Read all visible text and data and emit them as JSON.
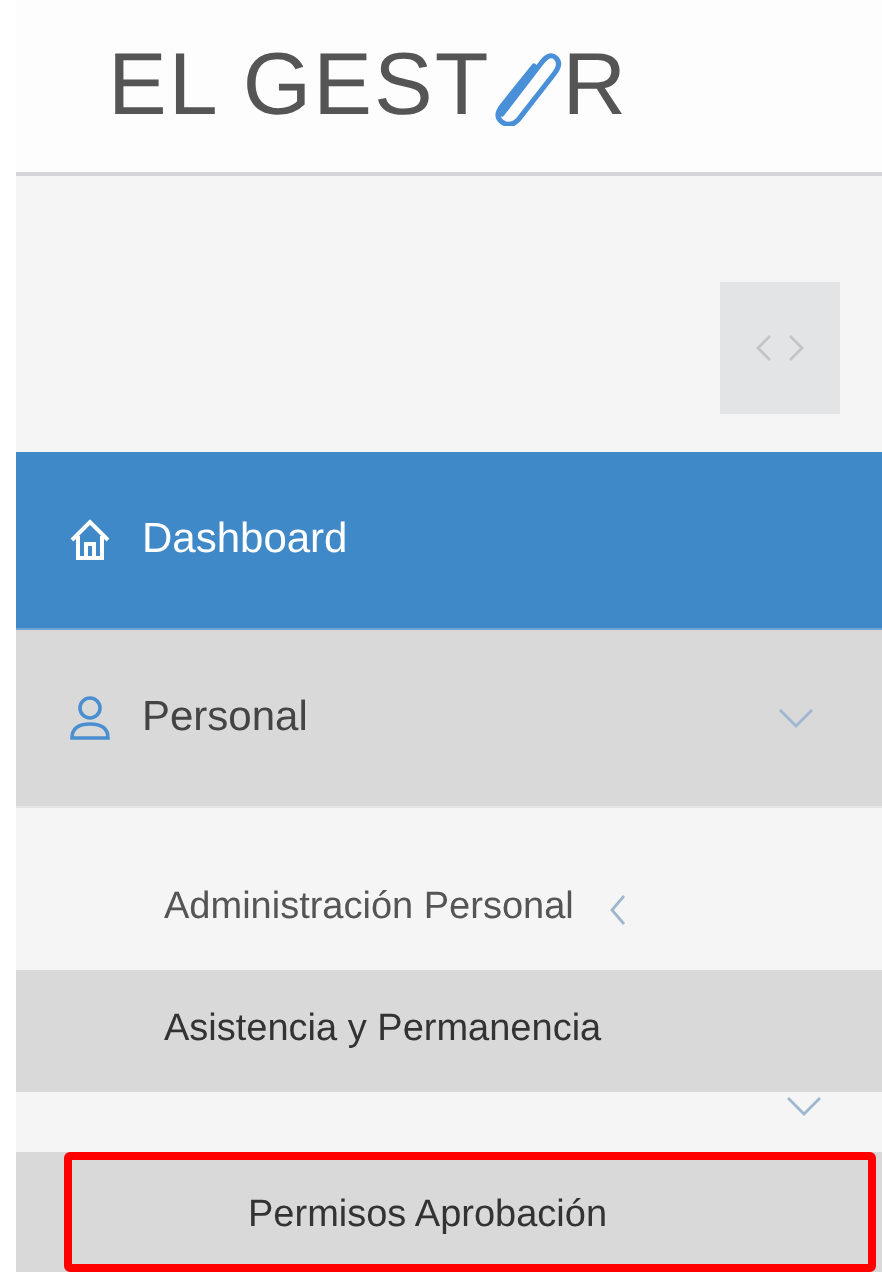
{
  "logo": {
    "text_before": "EL GEST",
    "text_after": "R"
  },
  "menu": [
    {
      "label": "Dashboard",
      "kind": "home",
      "selected": true,
      "expanded": false
    },
    {
      "label": "Personal",
      "kind": "user",
      "selected": false,
      "expanded": true,
      "children": [
        {
          "label": "Administración Personal",
          "selected": false,
          "expanded": false
        },
        {
          "label": "Asistencia y Permanencia",
          "selected": false,
          "expanded": true,
          "children": [
            {
              "label": "Permisos Aprobación",
              "selected": false,
              "highlighted": true
            }
          ]
        }
      ]
    }
  ]
}
